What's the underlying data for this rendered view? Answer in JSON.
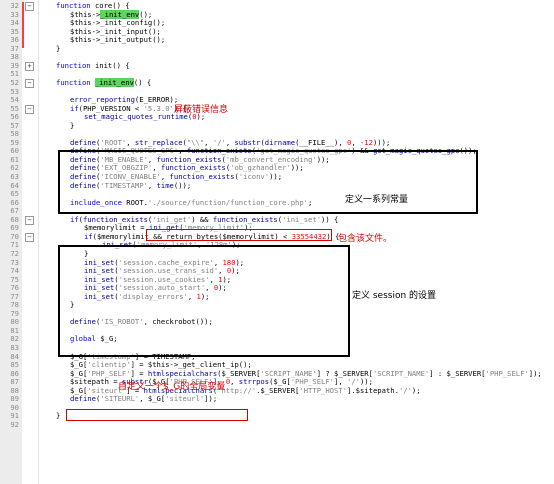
{
  "colors": {
    "gutter": "#ececec",
    "keyword": "#0000ff",
    "string": "#808080",
    "number": "#ff0000",
    "annotation": "#d40000",
    "highlight": "#5fd35f"
  },
  "icons": {
    "fold_open": "minus-box-icon",
    "fold_closed": "plus-box-icon"
  },
  "lines": [
    {
      "n": "32",
      "fold": "−",
      "indent": 0,
      "segs": [
        [
          "kw",
          "function"
        ],
        [
          "",
          " core() {"
        ]
      ]
    },
    {
      "n": "33",
      "fold": "",
      "indent": 1,
      "segs": [
        [
          "",
          "$this->"
        ],
        [
          "hl",
          "_init_env"
        ],
        [
          "",
          "();"
        ]
      ]
    },
    {
      "n": "34",
      "fold": "",
      "indent": 1,
      "segs": [
        [
          "",
          "$this->_init_config();"
        ]
      ]
    },
    {
      "n": "35",
      "fold": "",
      "indent": 1,
      "segs": [
        [
          "",
          "$this->_init_input();"
        ]
      ]
    },
    {
      "n": "36",
      "fold": "",
      "indent": 1,
      "segs": [
        [
          "",
          "$this->_init_output();"
        ]
      ]
    },
    {
      "n": "37",
      "fold": "",
      "indent": 0,
      "segs": [
        [
          "",
          "}"
        ]
      ]
    },
    {
      "n": "38",
      "fold": "",
      "indent": 0,
      "segs": []
    },
    {
      "n": "39",
      "fold": "+",
      "indent": 0,
      "segs": [
        [
          "kw",
          "function"
        ],
        [
          "",
          " init() {"
        ]
      ]
    },
    {
      "n": "51",
      "fold": "",
      "indent": 0,
      "segs": []
    },
    {
      "n": "52",
      "fold": "−",
      "indent": 0,
      "segs": [
        [
          "kw",
          "function"
        ],
        [
          "",
          " "
        ],
        [
          "hl",
          "_init_env"
        ],
        [
          "",
          "() {"
        ]
      ]
    },
    {
      "n": "53",
      "fold": "",
      "indent": 0,
      "segs": []
    },
    {
      "n": "54",
      "fold": "",
      "indent": 1,
      "segs": [
        [
          "fn",
          "error_reporting"
        ],
        [
          "",
          "(E_ERROR);"
        ]
      ]
    },
    {
      "n": "55",
      "fold": "−",
      "indent": 1,
      "segs": [
        [
          "kw",
          "if"
        ],
        [
          "",
          "(PHP_VERSION < "
        ],
        [
          "str",
          "'5.3.0'"
        ],
        [
          "",
          ") {"
        ]
      ]
    },
    {
      "n": "56",
      "fold": "",
      "indent": 2,
      "segs": [
        [
          "fn",
          "set_magic_quotes_runtime"
        ],
        [
          "",
          "("
        ],
        [
          "num",
          "0"
        ],
        [
          "",
          ");"
        ]
      ]
    },
    {
      "n": "57",
      "fold": "",
      "indent": 1,
      "segs": [
        [
          "",
          "}"
        ]
      ]
    },
    {
      "n": "58",
      "fold": "",
      "indent": 0,
      "segs": []
    },
    {
      "n": "59",
      "fold": "",
      "indent": 1,
      "segs": [
        [
          "fn",
          "define"
        ],
        [
          "",
          "("
        ],
        [
          "str",
          "'ROOT'"
        ],
        [
          "",
          ", "
        ],
        [
          "fn",
          "str_replace"
        ],
        [
          "",
          "("
        ],
        [
          "str",
          "\"\\\\\""
        ],
        [
          "",
          ", "
        ],
        [
          "str",
          "'/'"
        ],
        [
          "",
          ", "
        ],
        [
          "fn",
          "substr"
        ],
        [
          "",
          "("
        ],
        [
          "fn",
          "dirname"
        ],
        [
          "",
          "(__FILE__), "
        ],
        [
          "num",
          "0"
        ],
        [
          "",
          ", "
        ],
        [
          "num",
          "-12"
        ],
        [
          "",
          ")));"
        ]
      ]
    },
    {
      "n": "60",
      "fold": "",
      "indent": 1,
      "segs": [
        [
          "fn",
          "define"
        ],
        [
          "",
          "("
        ],
        [
          "str",
          "'MAGIC_QUOTES_GPC'"
        ],
        [
          "",
          ", "
        ],
        [
          "fn",
          "function_exists"
        ],
        [
          "",
          "("
        ],
        [
          "str",
          "'get_magic_quotes_gpc'"
        ],
        [
          "",
          ") && "
        ],
        [
          "fn",
          "get_magic_quotes_gpc"
        ],
        [
          "",
          "());"
        ]
      ]
    },
    {
      "n": "61",
      "fold": "",
      "indent": 1,
      "segs": [
        [
          "fn",
          "define"
        ],
        [
          "",
          "("
        ],
        [
          "str",
          "'MB_ENABLE'"
        ],
        [
          "",
          ", "
        ],
        [
          "fn",
          "function_exists"
        ],
        [
          "",
          "("
        ],
        [
          "str",
          "'mb_convert_encoding'"
        ],
        [
          "",
          "));"
        ]
      ]
    },
    {
      "n": "62",
      "fold": "",
      "indent": 1,
      "segs": [
        [
          "fn",
          "define"
        ],
        [
          "",
          "("
        ],
        [
          "str",
          "'EXT_OBGZIP'"
        ],
        [
          "",
          ", "
        ],
        [
          "fn",
          "function_exists"
        ],
        [
          "",
          "("
        ],
        [
          "str",
          "'ob_gzhandler'"
        ],
        [
          "",
          "));"
        ]
      ]
    },
    {
      "n": "63",
      "fold": "",
      "indent": 1,
      "segs": [
        [
          "fn",
          "define"
        ],
        [
          "",
          "("
        ],
        [
          "str",
          "'ICONV_ENABLE'"
        ],
        [
          "",
          ", "
        ],
        [
          "fn",
          "function_exists"
        ],
        [
          "",
          "("
        ],
        [
          "str",
          "'iconv'"
        ],
        [
          "",
          "));"
        ]
      ]
    },
    {
      "n": "64",
      "fold": "",
      "indent": 1,
      "segs": [
        [
          "fn",
          "define"
        ],
        [
          "",
          "("
        ],
        [
          "str",
          "'TIMESTAMP'"
        ],
        [
          "",
          ", "
        ],
        [
          "fn",
          "time"
        ],
        [
          "",
          "());"
        ]
      ]
    },
    {
      "n": "65",
      "fold": "",
      "indent": 0,
      "segs": []
    },
    {
      "n": "66",
      "fold": "",
      "indent": 1,
      "segs": [
        [
          "kw",
          "include_once"
        ],
        [
          "",
          " ROOT."
        ],
        [
          "str",
          "'./source/function/function_core.php'"
        ],
        [
          "",
          ";"
        ]
      ]
    },
    {
      "n": "67",
      "fold": "",
      "indent": 0,
      "segs": []
    },
    {
      "n": "68",
      "fold": "−",
      "indent": 1,
      "segs": [
        [
          "kw",
          "if"
        ],
        [
          "",
          "("
        ],
        [
          "fn",
          "function_exists"
        ],
        [
          "",
          "("
        ],
        [
          "str",
          "'ini_get'"
        ],
        [
          "",
          ") && "
        ],
        [
          "fn",
          "function_exists"
        ],
        [
          "",
          "("
        ],
        [
          "str",
          "'ini_set'"
        ],
        [
          "",
          ")) {"
        ]
      ]
    },
    {
      "n": "69",
      "fold": "",
      "indent": 2,
      "segs": [
        [
          "",
          "$memorylimit = "
        ],
        [
          "fn",
          "ini_get"
        ],
        [
          "",
          "("
        ],
        [
          "str",
          "'memory_limit'"
        ],
        [
          "",
          ");"
        ]
      ]
    },
    {
      "n": "70",
      "fold": "−",
      "indent": 2,
      "segs": [
        [
          "kw",
          "if"
        ],
        [
          "",
          "($memorylimit && return_bytes($memorylimit) < "
        ],
        [
          "num",
          "33554432"
        ],
        [
          "",
          ") {"
        ]
      ]
    },
    {
      "n": "71",
      "fold": "",
      "indent": 3,
      "segs": [
        [
          "fn",
          "ini_set"
        ],
        [
          "",
          "("
        ],
        [
          "str",
          "'memory_limit'"
        ],
        [
          "",
          ", "
        ],
        [
          "str",
          "'128m'"
        ],
        [
          "",
          ");"
        ]
      ]
    },
    {
      "n": "72",
      "fold": "",
      "indent": 2,
      "segs": [
        [
          "",
          "}"
        ]
      ]
    },
    {
      "n": "73",
      "fold": "",
      "indent": 2,
      "segs": [
        [
          "fn",
          "ini_set"
        ],
        [
          "",
          "("
        ],
        [
          "str",
          "'session.cache_expire'"
        ],
        [
          "",
          ", "
        ],
        [
          "num",
          "180"
        ],
        [
          "",
          ");"
        ]
      ]
    },
    {
      "n": "74",
      "fold": "",
      "indent": 2,
      "segs": [
        [
          "fn",
          "ini_set"
        ],
        [
          "",
          "("
        ],
        [
          "str",
          "'session.use_trans_sid'"
        ],
        [
          "",
          ", "
        ],
        [
          "num",
          "0"
        ],
        [
          "",
          ");"
        ]
      ]
    },
    {
      "n": "75",
      "fold": "",
      "indent": 2,
      "segs": [
        [
          "fn",
          "ini_set"
        ],
        [
          "",
          "("
        ],
        [
          "str",
          "'session.use_cookies'"
        ],
        [
          "",
          ", "
        ],
        [
          "num",
          "1"
        ],
        [
          "",
          ");"
        ]
      ]
    },
    {
      "n": "76",
      "fold": "",
      "indent": 2,
      "segs": [
        [
          "fn",
          "ini_set"
        ],
        [
          "",
          "("
        ],
        [
          "str",
          "'session.auto_start'"
        ],
        [
          "",
          ", "
        ],
        [
          "num",
          "0"
        ],
        [
          "",
          ");"
        ]
      ]
    },
    {
      "n": "77",
      "fold": "",
      "indent": 2,
      "segs": [
        [
          "fn",
          "ini_set"
        ],
        [
          "",
          "("
        ],
        [
          "str",
          "'display_errors'"
        ],
        [
          "",
          ", "
        ],
        [
          "num",
          "1"
        ],
        [
          "",
          ");"
        ]
      ]
    },
    {
      "n": "78",
      "fold": "",
      "indent": 1,
      "segs": [
        [
          "",
          "}"
        ]
      ]
    },
    {
      "n": "79",
      "fold": "",
      "indent": 0,
      "segs": []
    },
    {
      "n": "80",
      "fold": "",
      "indent": 1,
      "segs": [
        [
          "fn",
          "define"
        ],
        [
          "",
          "("
        ],
        [
          "str",
          "'IS_ROBOT'"
        ],
        [
          "",
          ", checkrobot());"
        ]
      ]
    },
    {
      "n": "81",
      "fold": "",
      "indent": 0,
      "segs": []
    },
    {
      "n": "82",
      "fold": "",
      "indent": 1,
      "segs": [
        [
          "kw",
          "global"
        ],
        [
          "",
          " $_G;"
        ]
      ]
    },
    {
      "n": "83",
      "fold": "",
      "indent": 0,
      "segs": []
    },
    {
      "n": "84",
      "fold": "",
      "indent": 1,
      "segs": [
        [
          "",
          "$_G["
        ],
        [
          "str",
          "'timestamp'"
        ],
        [
          "",
          "] = TIMESTAMP;"
        ]
      ]
    },
    {
      "n": "85",
      "fold": "",
      "indent": 1,
      "segs": [
        [
          "",
          "$_G["
        ],
        [
          "str",
          "'clientip'"
        ],
        [
          "",
          "] = $this->_get_client_ip();"
        ]
      ]
    },
    {
      "n": "86",
      "fold": "",
      "indent": 1,
      "segs": [
        [
          "",
          "$_G["
        ],
        [
          "str",
          "'PHP_SELF'"
        ],
        [
          "",
          "] = "
        ],
        [
          "fn",
          "htmlspecialchars"
        ],
        [
          "",
          "($_SERVER["
        ],
        [
          "str",
          "'SCRIPT_NAME'"
        ],
        [
          "",
          "] ? $_SERVER["
        ],
        [
          "str",
          "'SCRIPT_NAME'"
        ],
        [
          "",
          "] : $_SERVER["
        ],
        [
          "str",
          "'PHP_SELF'"
        ],
        [
          "",
          "]);"
        ]
      ]
    },
    {
      "n": "87",
      "fold": "",
      "indent": 1,
      "segs": [
        [
          "",
          "$sitepath = "
        ],
        [
          "fn",
          "substr"
        ],
        [
          "",
          "($_G["
        ],
        [
          "str",
          "'PHP_SELF'"
        ],
        [
          "",
          "], "
        ],
        [
          "num",
          "0"
        ],
        [
          "",
          ", "
        ],
        [
          "fn",
          "strrpos"
        ],
        [
          "",
          "($_G["
        ],
        [
          "str",
          "'PHP_SELF'"
        ],
        [
          "",
          "], "
        ],
        [
          "str",
          "'/'"
        ],
        [
          "",
          "));"
        ]
      ]
    },
    {
      "n": "88",
      "fold": "",
      "indent": 1,
      "segs": [
        [
          "",
          "$_G["
        ],
        [
          "str",
          "'siteurl'"
        ],
        [
          "",
          "] = "
        ],
        [
          "fn",
          "htmlspecialchars"
        ],
        [
          "",
          "("
        ],
        [
          "str",
          "'http://'"
        ],
        [
          "",
          ".$_SERVER["
        ],
        [
          "str",
          "'HTTP_HOST'"
        ],
        [
          "",
          "].$sitepath."
        ],
        [
          "str",
          "'/'"
        ],
        [
          "",
          ");"
        ]
      ]
    },
    {
      "n": "89",
      "fold": "",
      "indent": 1,
      "segs": [
        [
          "fn",
          "define"
        ],
        [
          "",
          "("
        ],
        [
          "str",
          "'SITEURL'"
        ],
        [
          "",
          ", $_G["
        ],
        [
          "str",
          "'siteurl'"
        ],
        [
          "",
          "]);"
        ]
      ]
    },
    {
      "n": "90",
      "fold": "",
      "indent": 0,
      "segs": []
    },
    {
      "n": "91",
      "fold": "",
      "indent": 0,
      "segs": [
        [
          "",
          "}"
        ]
      ]
    },
    {
      "n": "92",
      "fold": "",
      "indent": 0,
      "segs": []
    }
  ],
  "annotations": {
    "error_reporting": "屏蔽错误信息",
    "define_constants": "定义一系列常量",
    "include_file": "包含该文件。",
    "session_settings": "定义 session 的设置",
    "global_var": "自定义一个$_G的全局变量"
  }
}
